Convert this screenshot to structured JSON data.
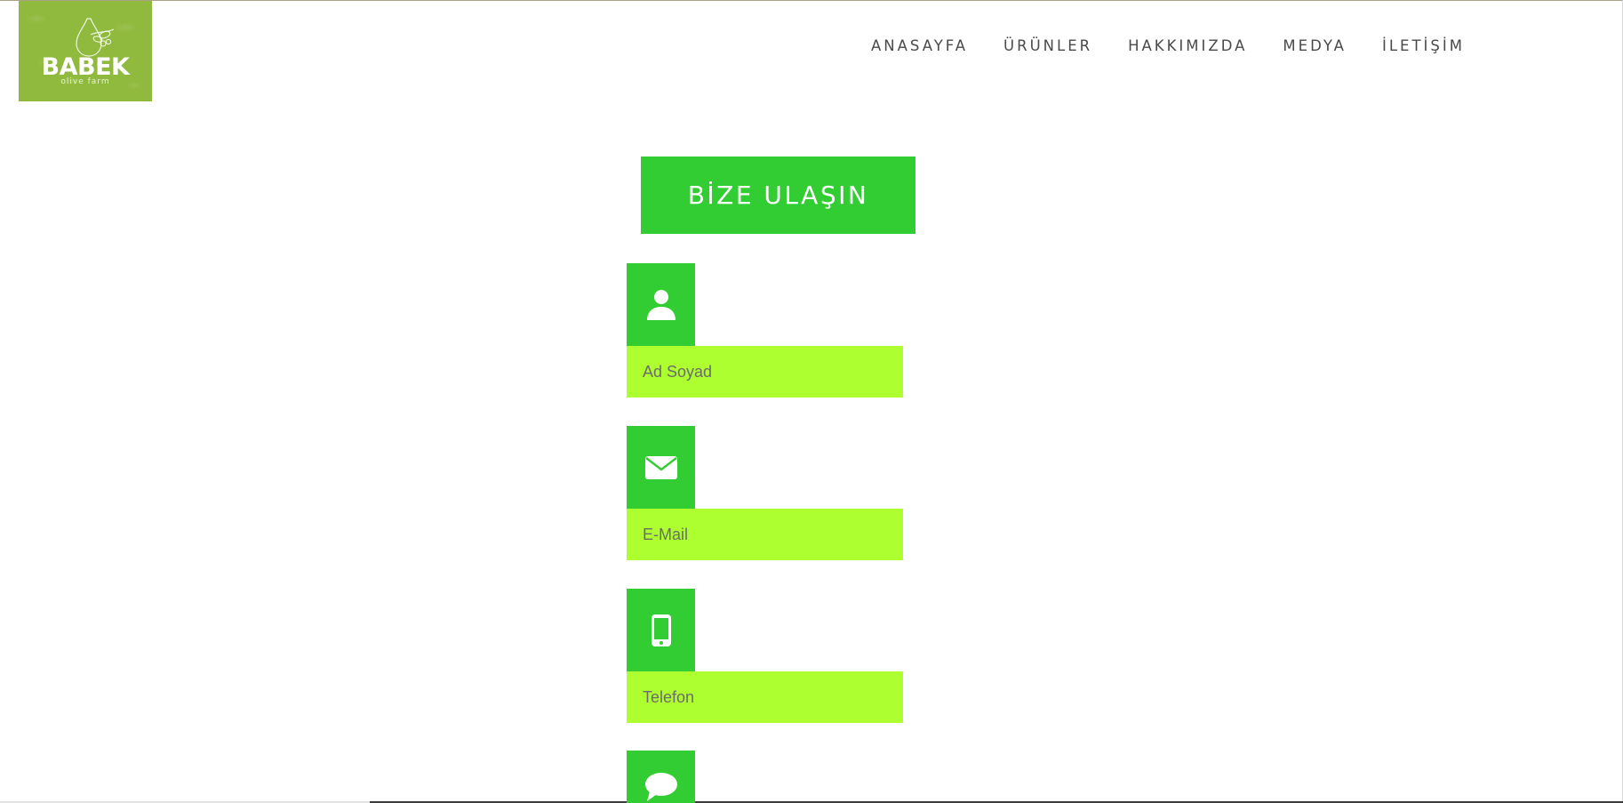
{
  "logo": {
    "title": "BABEK",
    "subtitle": "olive farm",
    "background_color": "#8fba3d"
  },
  "nav": {
    "items": [
      {
        "label": "ANASAYFA"
      },
      {
        "label": "ÜRÜNLER"
      },
      {
        "label": "HAKKIMIZDA"
      },
      {
        "label": "MEDYA"
      },
      {
        "label": "İLETİŞİM"
      }
    ],
    "text_color": "#4a4a4a"
  },
  "contact": {
    "heading": "BİZE ULAŞIN",
    "accent_color": "#32cd32",
    "field_color": "#adff2f",
    "fields": [
      {
        "icon": "user-icon",
        "placeholder": "Ad Soyad",
        "value": ""
      },
      {
        "icon": "envelope-icon",
        "placeholder": "E-Mail",
        "value": ""
      },
      {
        "icon": "mobile-phone-icon",
        "placeholder": "Telefon",
        "value": ""
      },
      {
        "icon": "speech-bubble-icon",
        "placeholder": "",
        "value": ""
      }
    ]
  }
}
